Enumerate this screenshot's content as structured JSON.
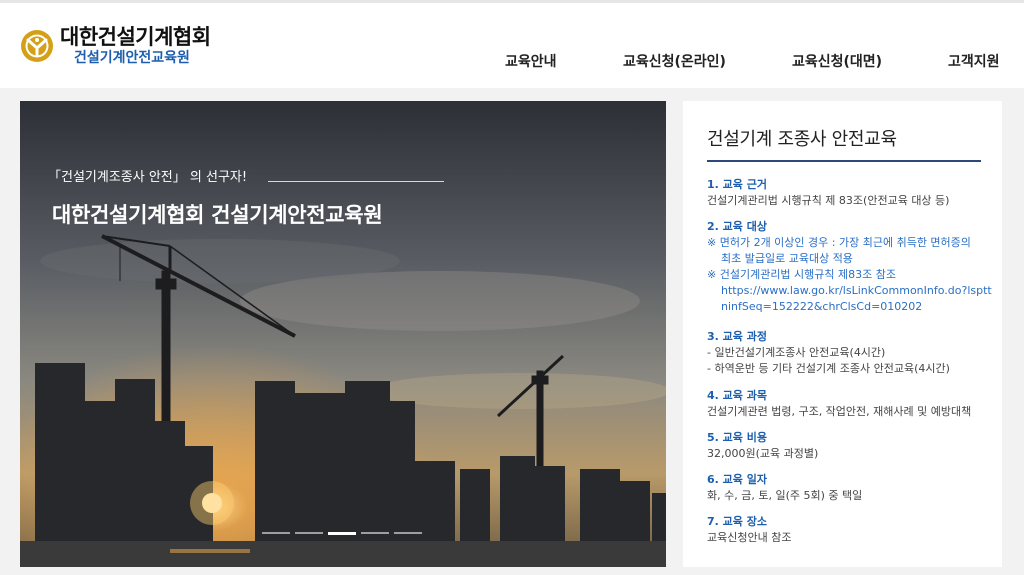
{
  "header": {
    "logo_title": "대한건설기계협회",
    "logo_subtitle": "건설기계안전교육원",
    "nav": [
      "교육안내",
      "교육신청(온라인)",
      "교육신청(대면)",
      "고객지원"
    ]
  },
  "hero": {
    "tagline": "「건설기계조종사 안전」 의 선구자!",
    "title": "대한건설기계협회 건설기계안전교육원",
    "slide_count": 5,
    "active_slide": 3
  },
  "panel": {
    "title": "건설기계 조종사 안전교육",
    "sections": [
      {
        "heading": "1. 교육 근거",
        "lines": [
          "건설기계관리법 시행규칙 제 83조(안전교육 대상 등)"
        ]
      },
      {
        "heading": "2. 교육 대상",
        "notes": [
          "※ 면허가 2개 이상인 경우 : 가장 최근에 취득한 면허증의",
          "최초 발급일로 교육대상 적용",
          "※ 건설기계관리법 시행규칙 제83조 참조",
          "https://www.law.go.kr/lsLinkCommonInfo.do?lsptt",
          "ninfSeq=152222&chrClsCd=010202"
        ]
      },
      {
        "heading": "3. 교육 과정",
        "lines": [
          "- 일반건설기계조종사 안전교육(4시간)",
          "- 하역운반 등 기타 건설기계 조종사 안전교육(4시간)"
        ]
      },
      {
        "heading": "4. 교육 과목",
        "lines": [
          "건설기계관련 법령, 구조, 작업안전, 재해사례 및 예방대책"
        ]
      },
      {
        "heading": "5. 교육 비용",
        "lines": [
          "32,000원(교육 과정별)"
        ]
      },
      {
        "heading": "6. 교육 일자",
        "lines": [
          "화, 수, 금, 토, 일(주 5회) 중 택일"
        ]
      },
      {
        "heading": "7. 교육 장소",
        "lines": [
          "교육신청안내 참조"
        ]
      }
    ]
  },
  "colors": {
    "accent": "#1d5fae",
    "rule": "#2b4a7a",
    "logo_gold": "#d4a017"
  },
  "icons": [
    "logo-emblem-icon"
  ]
}
